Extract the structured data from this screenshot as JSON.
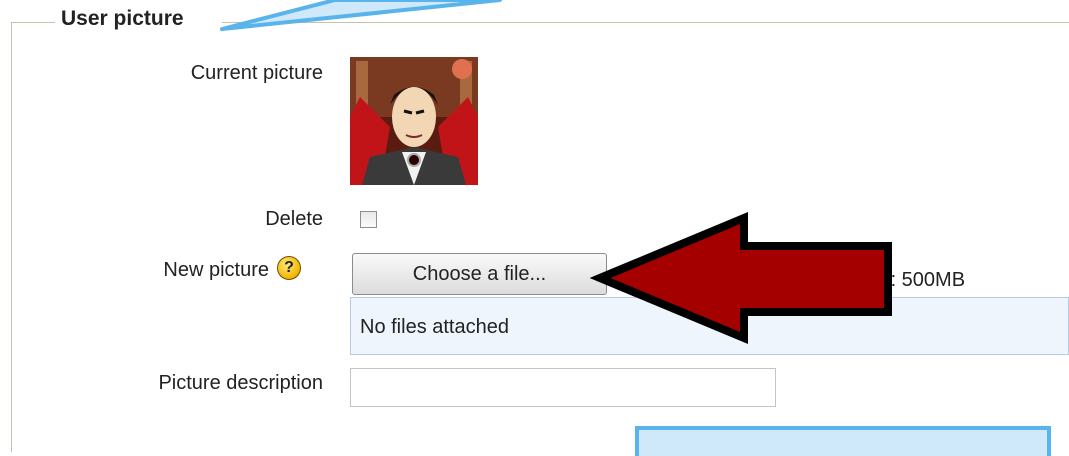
{
  "section": {
    "legend": "User picture"
  },
  "fields": {
    "current_picture_label": "Current picture",
    "delete_label": "Delete",
    "new_picture_label": "New picture",
    "help_glyph": "?",
    "choose_button": "Choose a file...",
    "max_size_text": "les: 500MB",
    "files_status": "No files attached",
    "picture_description_label": "Picture description",
    "picture_description_value": ""
  },
  "state": {
    "delete_checked": false
  },
  "colors": {
    "arrow_fill": "#a50000",
    "callout_fill": "#cfe9fb",
    "callout_border": "#5ab4ec",
    "files_box_bg": "#eef5fc"
  },
  "icons": {
    "help": "help-icon",
    "avatar": "user-avatar-image"
  }
}
